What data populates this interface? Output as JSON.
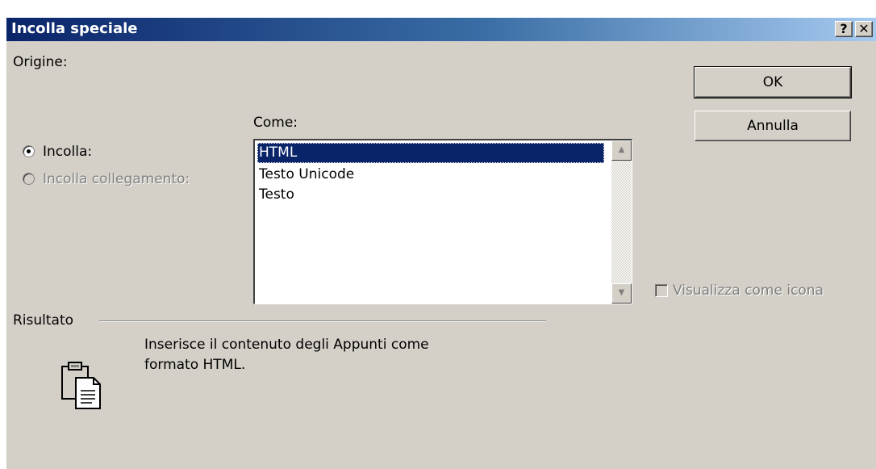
{
  "dialog": {
    "title": "Incolla speciale",
    "help_label": "?",
    "close_label": "✕"
  },
  "source": {
    "label": "Origine:"
  },
  "paste_options": {
    "paste_label": "Incolla:",
    "paste_link_label": "Incolla collegamento:",
    "selected": "Incolla"
  },
  "as_list": {
    "label": "Come:",
    "items": [
      "HTML",
      "Testo Unicode",
      "Testo"
    ],
    "selected_index": 0
  },
  "buttons": {
    "ok": "OK",
    "cancel": "Annulla"
  },
  "display_as_icon": {
    "label": "Visualizza come icona",
    "checked": false
  },
  "result": {
    "label": "Risultato",
    "description": [
      "Inserisce il contenuto degli Appunti come",
      "formato HTML."
    ]
  },
  "icons": {
    "clipboard": "clipboard-icon",
    "scroll_up": "scroll-up-icon",
    "scroll_down": "scroll-down-icon"
  }
}
